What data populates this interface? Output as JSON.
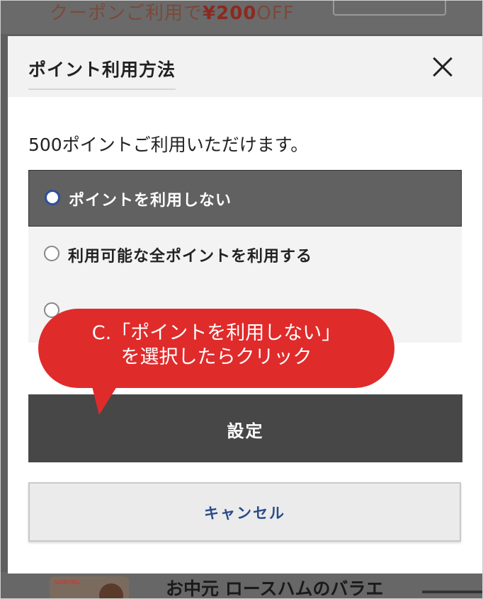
{
  "background": {
    "coupon_prefix": "クーポンご利用で",
    "coupon_amount": "¥200",
    "coupon_suffix": "OFF",
    "product_title": "お中元 ロースハムのバラエ",
    "thumb_logo": "SAIBORG"
  },
  "modal": {
    "title": "ポイント利用方法",
    "close_icon": "close-icon",
    "available_text": "500ポイントご利用いただけます。",
    "options": [
      {
        "label": "ポイントを利用しない",
        "selected": true
      },
      {
        "label": "利用可能な全ポイントを利用する",
        "selected": false
      },
      {
        "label": "",
        "selected": false
      }
    ],
    "set_button": "設定",
    "cancel_button": "キャンセル"
  },
  "callout": {
    "line1": "C.「ポイントを利用しない」",
    "line2": "を選択したらクリック",
    "color": "#e02b2b"
  },
  "colors": {
    "selected_option_bg": "#616161",
    "set_button_bg": "#474747",
    "cancel_text": "#2b4a8a",
    "radio_selected": "#2d4fa0"
  }
}
